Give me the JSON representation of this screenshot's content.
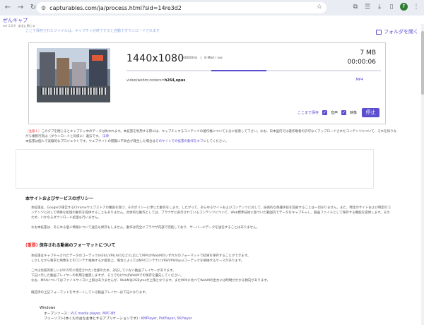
{
  "browser": {
    "url": "capturables.com/ja/process.html?sid=14re3d2"
  },
  "app": {
    "logo": "ぜんキャプ",
    "version": "ver 1.0.9",
    "version_note": "安全に閉じる",
    "folder_link": "フォルダを開く",
    "top_link": "ここで保存されたファイルは、キャプチャが終了すると自動でダウンロードされます"
  },
  "capture": {
    "resolution": "1440x1080",
    "audio_rate": "48000Hz",
    "bitrate": "8 Mbit / sec",
    "size": "7 MB",
    "elapsed": "00:00:06",
    "codec_prefix": "video/webm;codecs=",
    "codec_value": "h264,opus",
    "format": "MP4",
    "progress": 0.55,
    "save_here": "ここまで保存",
    "audio_label": "音声",
    "video_label": "映像",
    "stop_label": "停止"
  },
  "note": {
    "tag": "（注意１）",
    "line1": "このタブを閉じるとキャプチャ中のデータは失われます。本拡張を利用する際には、キャプチャするコンテンツの著作権について十分に留意して下さい。なお、日本国内では著作権者の許可なくアップロードされたコンテンツについて、それを知りながら複製行為は（ダウンロードと同様に）違法です。",
    "line1_link": "法律",
    "line2": "本拡張は個人で実験的なプロジェクトです。ウェブサイトの閲覧に不具合が発生した場合は",
    "line2_link": "そのサイトでの拡張の動作をオフ",
    "line2_end": "にしてください。"
  },
  "policy": {
    "heading": "本サイトおよびサービスのポリシー",
    "p1": "本拡張は、Googleが運営するChromeウェブストアの審査を受け、そのポリシーに準じた動作をします。したがって、あらゆるサイトおよびコンテンツに対して、技術的な保護手段を回避することは一切ありません。また、特定のサイトおよび特定のコンテンツに対して特殊な処理の動作を提供することもありません。具体的な動作としては、ブラウザに表示されているコンテンツについて、Web標準技術に基づいた範囲内でデータをキャプチャし、動画ファイルとして保存する機能を提供します。そのため、いかなるダウンロード処理も行いません。",
    "p2": "なお本拡張は、あらゆる個人情報について送信も保存もしません。動作は完全にブラウザ内部で完結しており、サーバーにデータを送信することはありません。"
  },
  "format_section": {
    "mark": "(重要)",
    "heading": "保存される動画のフォーマットについて",
    "p1": "本拡張はキャプチャされたデータのコーデック(H264,VP8,AV1など)に応じてMP4かWebMのいずれかのフォーマットで結果を保存することができます。",
    "p2": "しかしながら要求と映像をどのコンテナ格納するか都合上、場合によってはMP4コンテナにVP8/VP9/Opusコーデックを格納するケースがあります。",
    "p3": "これは比較的新しい(2015年に策定された) 仕様のため、対応していない動画プレイヤーがあります。",
    "p4": "下記に示した動画プレイヤーの利用を推奨しますが、そうでなければWebMでの保存を優先してください。",
    "p5": "なお、MP4についてはファイルサイズに上限はありませんが、WebMは2GBytesが上限となります。またMP4に比べてWebMの出力には時間がかかる傾向があります。",
    "p6": "確認済の上記フォーマットをサポートしている動画プレイヤーは下記になります。",
    "os": "Windows",
    "players_label": "オープンソース : ",
    "player1": "VLC media player",
    "player2": "MPC-BE",
    "free_label": "フリーソフト(本くだの古な主体とするアプリケーションです) : ",
    "free1": "KMPlayer",
    "free2": "PotPlayer",
    "free3": "5KPlayer"
  }
}
